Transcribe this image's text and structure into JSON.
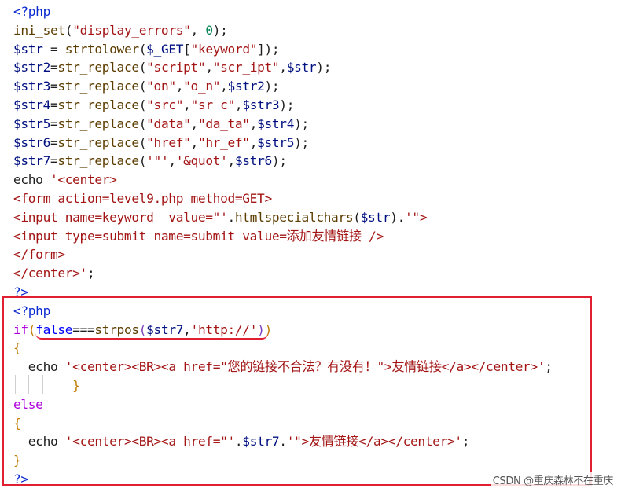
{
  "code": {
    "lines": [
      [
        {
          "t": "<?php",
          "c": "tag"
        }
      ],
      [
        {
          "t": "ini_set",
          "c": "func"
        },
        {
          "t": "(",
          "c": "default"
        },
        {
          "t": "\"display_errors\"",
          "c": "str"
        },
        {
          "t": ", ",
          "c": "default"
        },
        {
          "t": "0",
          "c": "num"
        },
        {
          "t": ");",
          "c": "default"
        }
      ],
      [
        {
          "t": "$str",
          "c": "var"
        },
        {
          "t": " = ",
          "c": "default"
        },
        {
          "t": "strtolower",
          "c": "func"
        },
        {
          "t": "(",
          "c": "default"
        },
        {
          "t": "$_GET",
          "c": "var"
        },
        {
          "t": "[",
          "c": "default"
        },
        {
          "t": "\"keyword\"",
          "c": "str"
        },
        {
          "t": "]);",
          "c": "default"
        }
      ],
      [
        {
          "t": "$str2",
          "c": "var"
        },
        {
          "t": "=",
          "c": "default"
        },
        {
          "t": "str_replace",
          "c": "func"
        },
        {
          "t": "(",
          "c": "default"
        },
        {
          "t": "\"script\"",
          "c": "str"
        },
        {
          "t": ",",
          "c": "default"
        },
        {
          "t": "\"scr_ipt\"",
          "c": "str"
        },
        {
          "t": ",",
          "c": "default"
        },
        {
          "t": "$str",
          "c": "var"
        },
        {
          "t": ");",
          "c": "default"
        }
      ],
      [
        {
          "t": "$str3",
          "c": "var"
        },
        {
          "t": "=",
          "c": "default"
        },
        {
          "t": "str_replace",
          "c": "func"
        },
        {
          "t": "(",
          "c": "default"
        },
        {
          "t": "\"on\"",
          "c": "str"
        },
        {
          "t": ",",
          "c": "default"
        },
        {
          "t": "\"o_n\"",
          "c": "str"
        },
        {
          "t": ",",
          "c": "default"
        },
        {
          "t": "$str2",
          "c": "var"
        },
        {
          "t": ");",
          "c": "default"
        }
      ],
      [
        {
          "t": "$str4",
          "c": "var"
        },
        {
          "t": "=",
          "c": "default"
        },
        {
          "t": "str_replace",
          "c": "func"
        },
        {
          "t": "(",
          "c": "default"
        },
        {
          "t": "\"src\"",
          "c": "str"
        },
        {
          "t": ",",
          "c": "default"
        },
        {
          "t": "\"sr_c\"",
          "c": "str"
        },
        {
          "t": ",",
          "c": "default"
        },
        {
          "t": "$str3",
          "c": "var"
        },
        {
          "t": ");",
          "c": "default"
        }
      ],
      [
        {
          "t": "$str5",
          "c": "var"
        },
        {
          "t": "=",
          "c": "default"
        },
        {
          "t": "str_replace",
          "c": "func"
        },
        {
          "t": "(",
          "c": "default"
        },
        {
          "t": "\"data\"",
          "c": "str"
        },
        {
          "t": ",",
          "c": "default"
        },
        {
          "t": "\"da_ta\"",
          "c": "str"
        },
        {
          "t": ",",
          "c": "default"
        },
        {
          "t": "$str4",
          "c": "var"
        },
        {
          "t": ");",
          "c": "default"
        }
      ],
      [
        {
          "t": "$str6",
          "c": "var"
        },
        {
          "t": "=",
          "c": "default"
        },
        {
          "t": "str_replace",
          "c": "func"
        },
        {
          "t": "(",
          "c": "default"
        },
        {
          "t": "\"href\"",
          "c": "str"
        },
        {
          "t": ",",
          "c": "default"
        },
        {
          "t": "\"hr_ef\"",
          "c": "str"
        },
        {
          "t": ",",
          "c": "default"
        },
        {
          "t": "$str5",
          "c": "var"
        },
        {
          "t": ");",
          "c": "default"
        }
      ],
      [
        {
          "t": "$str7",
          "c": "var"
        },
        {
          "t": "=",
          "c": "default"
        },
        {
          "t": "str_replace",
          "c": "func"
        },
        {
          "t": "(",
          "c": "default"
        },
        {
          "t": "'\"'",
          "c": "str"
        },
        {
          "t": ",",
          "c": "default"
        },
        {
          "t": "'&quot'",
          "c": "str"
        },
        {
          "t": ",",
          "c": "default"
        },
        {
          "t": "$str6",
          "c": "var"
        },
        {
          "t": ");",
          "c": "default"
        }
      ],
      [
        {
          "t": "echo ",
          "c": "default"
        },
        {
          "t": "'<center>",
          "c": "html"
        }
      ],
      [
        {
          "t": "<form action=level9.php method=GET>",
          "c": "html"
        }
      ],
      [
        {
          "t": "<input name=keyword  value=\"'",
          "c": "html"
        },
        {
          "t": ".",
          "c": "default"
        },
        {
          "t": "htmlspecialchars",
          "c": "func"
        },
        {
          "t": "(",
          "c": "default"
        },
        {
          "t": "$str",
          "c": "var"
        },
        {
          "t": ").",
          "c": "default"
        },
        {
          "t": "'\">",
          "c": "html"
        }
      ],
      [
        {
          "t": "<input type=submit name=submit value=添加友情链接 />",
          "c": "html"
        }
      ],
      [
        {
          "t": "</form>",
          "c": "html"
        }
      ],
      [
        {
          "t": "</center>'",
          "c": "html"
        },
        {
          "t": ";",
          "c": "default"
        }
      ],
      [
        {
          "t": "?>",
          "c": "tag"
        }
      ],
      [
        {
          "t": "<?php",
          "c": "tag"
        }
      ],
      [
        {
          "t": "if",
          "c": "ctrl"
        },
        {
          "t": "(",
          "c": "brace"
        },
        {
          "t": "false",
          "c": "kw"
        },
        {
          "t": "===",
          "c": "default"
        },
        {
          "t": "strpos",
          "c": "func"
        },
        {
          "t": "(",
          "c": "braceb"
        },
        {
          "t": "$str7",
          "c": "var"
        },
        {
          "t": ",",
          "c": "default"
        },
        {
          "t": "'http://'",
          "c": "str"
        },
        {
          "t": ")",
          "c": "braceb"
        },
        {
          "t": ")",
          "c": "brace"
        }
      ],
      [
        {
          "t": "{",
          "c": "brace"
        }
      ],
      [
        {
          "t": "  echo ",
          "c": "default"
        },
        {
          "t": "'<center><BR><a href=\"您的链接不合法？有没有！\">友情链接</a></center>'",
          "c": "html"
        },
        {
          "t": ";",
          "c": "default"
        }
      ],
      [
        {
          "t": "        }",
          "c": "brace"
        }
      ],
      [
        {
          "t": "else",
          "c": "ctrl"
        }
      ],
      [
        {
          "t": "{",
          "c": "brace"
        }
      ],
      [
        {
          "t": "  echo ",
          "c": "default"
        },
        {
          "t": "'<center><BR><a href=\"'",
          "c": "html"
        },
        {
          "t": ".",
          "c": "default"
        },
        {
          "t": "$str7",
          "c": "var"
        },
        {
          "t": ".",
          "c": "default"
        },
        {
          "t": "'\">友情链接</a></center>'",
          "c": "html"
        },
        {
          "t": ";",
          "c": "default"
        }
      ],
      [
        {
          "t": "}",
          "c": "brace"
        }
      ],
      [
        {
          "t": "?>",
          "c": "tag"
        }
      ]
    ]
  },
  "watermark": "CSDN @重庆森林不在重庆"
}
